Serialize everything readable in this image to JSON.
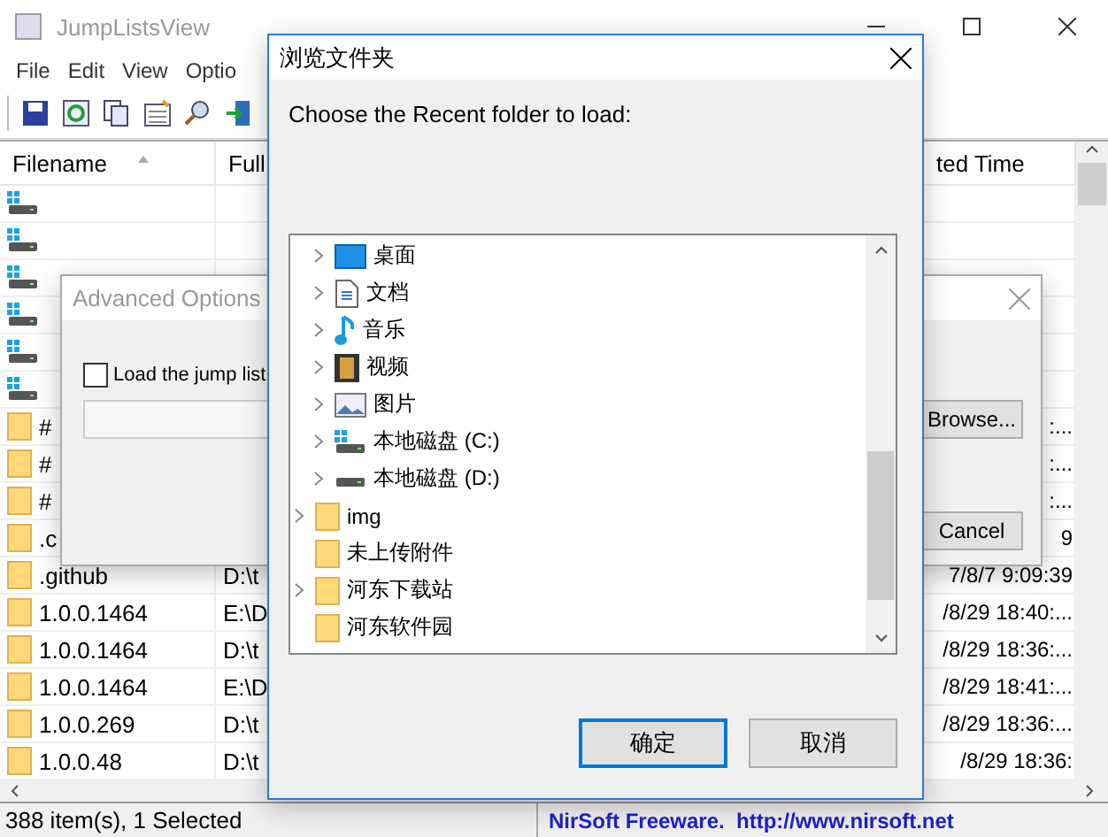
{
  "window": {
    "title": "JumpListsView"
  },
  "menu": [
    "File",
    "Edit",
    "View",
    "Optio"
  ],
  "table": {
    "columns": [
      {
        "label": "Filename",
        "sorted": true
      },
      {
        "label": "Full"
      },
      {
        "label": "ted Time"
      }
    ],
    "rows": [
      {
        "kind": "drive"
      },
      {
        "kind": "drive"
      },
      {
        "kind": "drive"
      },
      {
        "kind": "drive"
      },
      {
        "kind": "drive"
      },
      {
        "kind": "drive"
      },
      {
        "kind": "folder",
        "filename": "#",
        "time": ":..."
      },
      {
        "kind": "folder",
        "filename": "#",
        "time": ":..."
      },
      {
        "kind": "folder",
        "filename": "#",
        "time": ":..."
      },
      {
        "kind": "folder",
        "filename": ".c",
        "time": "9"
      },
      {
        "kind": "folder",
        "filename": ".github",
        "path": "D:\\t",
        "time": "7/8/7 9:09:39"
      },
      {
        "kind": "folder",
        "filename": "1.0.0.1464",
        "path": "E:\\D",
        "time": "/8/29 18:40:..."
      },
      {
        "kind": "folder",
        "filename": "1.0.0.1464",
        "path": "D:\\t",
        "time": "/8/29 18:36:..."
      },
      {
        "kind": "folder",
        "filename": "1.0.0.1464",
        "path": "E:\\D",
        "time": "/8/29 18:41:..."
      },
      {
        "kind": "folder",
        "filename": "1.0.0.269",
        "path": "D:\\t",
        "time": "/8/29 18:36:..."
      },
      {
        "kind": "folder",
        "filename": "1.0.0.48",
        "path": "D:\\t",
        "time": "/8/29 18:36:"
      }
    ]
  },
  "status_bar": {
    "count": "388 item(s), 1 Selected",
    "credit": "NirSoft Freeware.  http://www.nirsoft.net"
  },
  "advanced_dialog": {
    "title": "Advanced Options",
    "checkbox": {
      "label": "Load the jump list",
      "checked": false
    },
    "browse_button": "Browse...",
    "cancel_button": "Cancel"
  },
  "browse_dialog": {
    "title": "浏览文件夹",
    "prompt": "Choose the Recent folder to load:",
    "tree": [
      {
        "children": [
          {
            "kind": "desktop",
            "label": "桌面",
            "expandable": true
          },
          {
            "kind": "document",
            "label": "文档",
            "expandable": true
          },
          {
            "kind": "music",
            "label": "音乐",
            "expandable": true
          },
          {
            "kind": "video",
            "label": "视频",
            "expandable": true
          },
          {
            "kind": "picture",
            "label": "图片",
            "expandable": true
          },
          {
            "kind": "system-drive",
            "label": "本地磁盘 (C:)",
            "expandable": true
          },
          {
            "kind": "drive",
            "label": "本地磁盘 (D:)",
            "expandable": true
          }
        ]
      },
      {
        "kind": "folder",
        "label": "img",
        "expandable": true
      },
      {
        "kind": "folder",
        "label": "未上传附件",
        "expandable": false
      },
      {
        "kind": "folder",
        "label": "河东下载站",
        "expandable": true
      },
      {
        "kind": "folder",
        "label": "河东软件园",
        "expandable": false
      }
    ],
    "buttons": [
      {
        "label": "确定",
        "default": true
      },
      {
        "label": "取消",
        "default": false
      }
    ]
  }
}
